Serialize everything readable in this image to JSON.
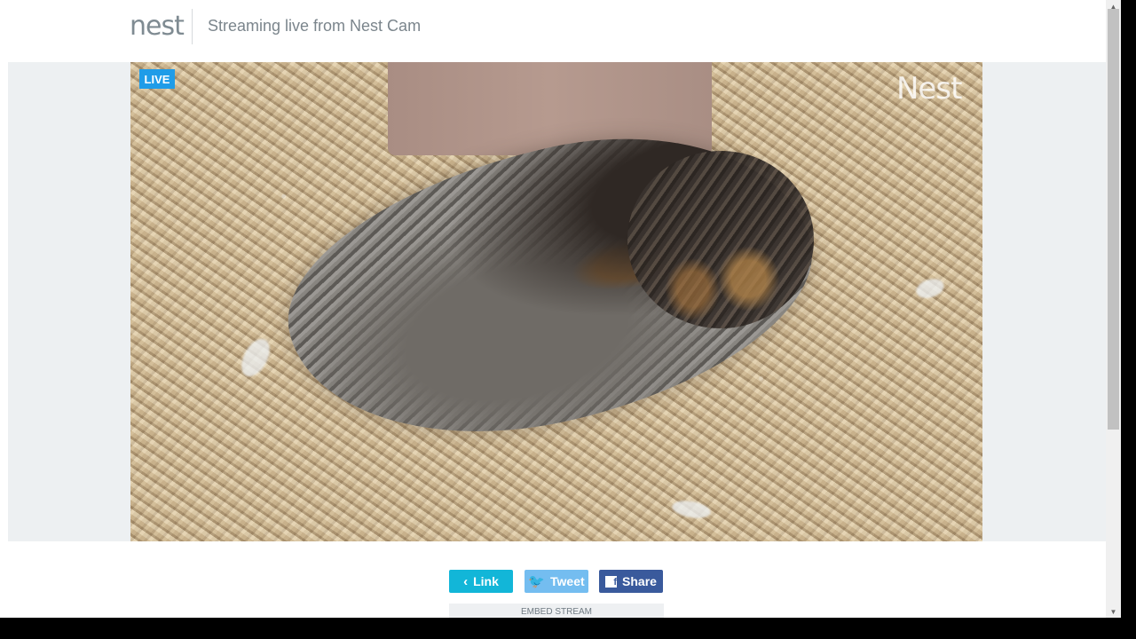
{
  "header": {
    "logo": "nest",
    "title": "Streaming live from Nest Cam"
  },
  "video": {
    "live_badge": "LIVE",
    "watermark": "Nest"
  },
  "share": {
    "link_label": "Link",
    "tweet_label": "Tweet",
    "share_label": "Share",
    "embed_label": "EMBED STREAM"
  },
  "icons": {
    "link": "chevron-left-icon",
    "tweet": "twitter-icon",
    "share": "facebook-icon",
    "scroll_up": "chevron-up-icon",
    "scroll_down": "chevron-down-icon"
  },
  "colors": {
    "live": "#1f9ce8",
    "link": "#12b6d8",
    "tweet": "#74bdf0",
    "share": "#3a5a9c"
  }
}
